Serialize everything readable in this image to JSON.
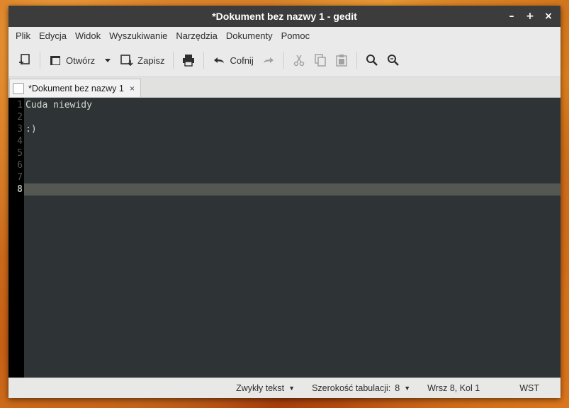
{
  "window": {
    "title": "*Dokument bez nazwy 1 - gedit",
    "controls": {
      "minimize": "–",
      "maximize": "+",
      "close": "×"
    }
  },
  "menu": [
    {
      "label": "Plik"
    },
    {
      "label": "Edycja"
    },
    {
      "label": "Widok"
    },
    {
      "label": "Wyszukiwanie"
    },
    {
      "label": "Narzędzia"
    },
    {
      "label": "Dokumenty"
    },
    {
      "label": "Pomoc"
    }
  ],
  "toolbar": {
    "open_label": "Otwórz",
    "save_label": "Zapisz",
    "undo_label": "Cofnij"
  },
  "tab": {
    "label": "*Dokument bez nazwy 1",
    "close": "×"
  },
  "editor": {
    "line_numbers": [
      "1",
      "2",
      "3",
      "4",
      "5",
      "6",
      "7",
      "8"
    ],
    "lines": [
      "Cuda niewidy",
      "",
      ":)",
      "",
      "",
      "",
      "",
      ""
    ],
    "current_line": 8
  },
  "statusbar": {
    "language": "Zwykły tekst",
    "tab_width_label": "Szerokość tabulacji:",
    "tab_width_value": "8",
    "cursor_position": "Wrsz 8, Kol 1",
    "insert_mode": "WST"
  },
  "colors": {
    "editor_bg": "#2e3436",
    "gutter_bg": "#000000",
    "current_line_bg": "#555753",
    "titlebar_bg": "#3c3c3c"
  }
}
